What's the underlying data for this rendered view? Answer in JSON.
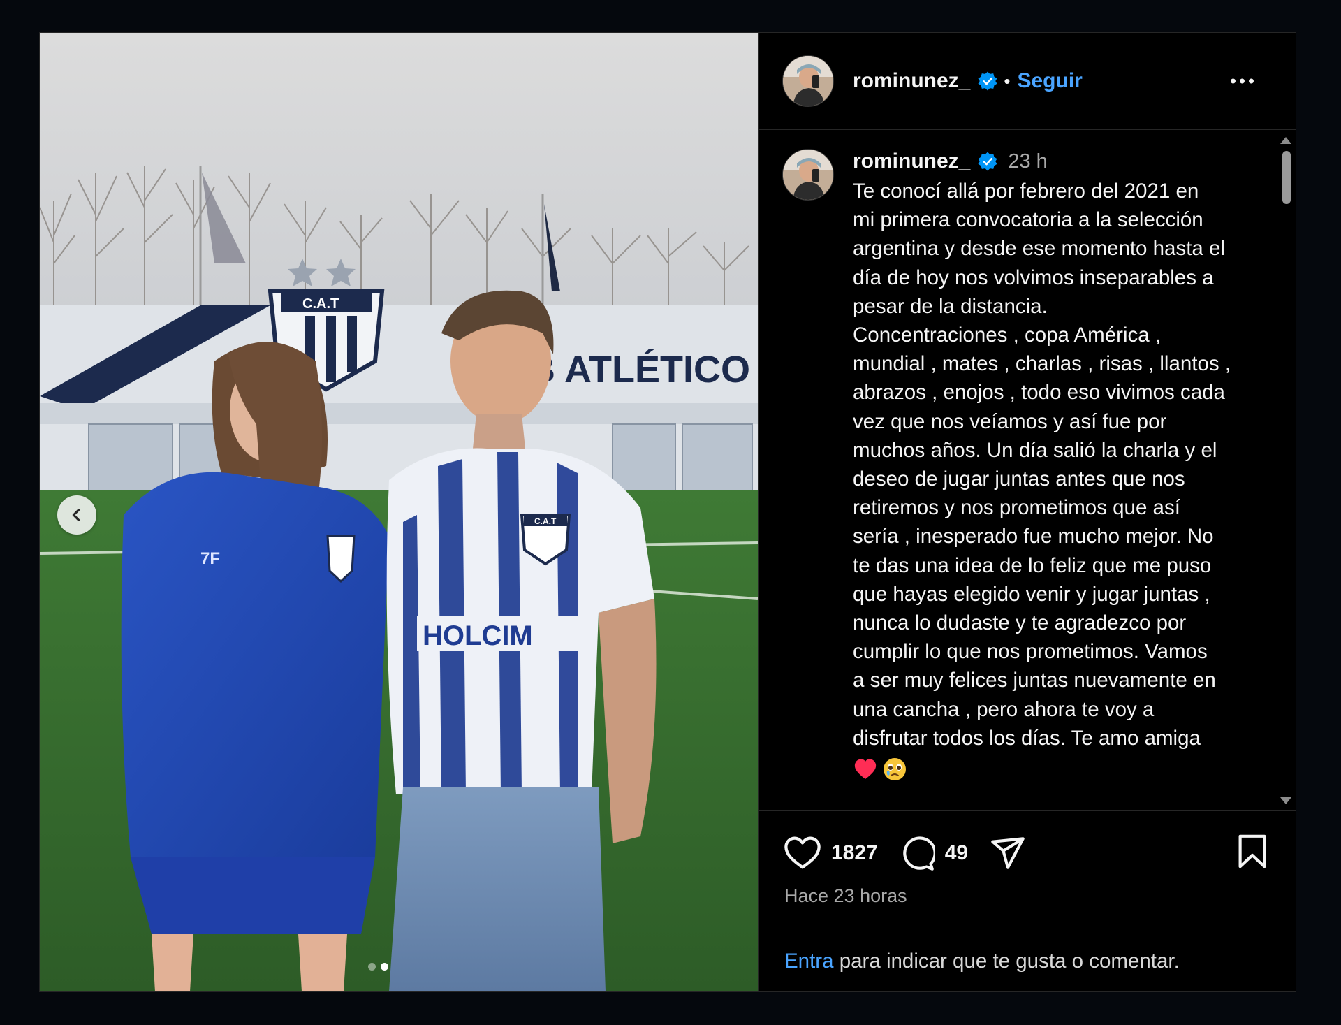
{
  "post": {
    "username": "rominunez_",
    "follow_label": "Seguir",
    "separator": "•",
    "caption_time": "23 h",
    "caption_text": "Te conocí allá por febrero del 2021 en\nmi primera convocatoria a la selección\nargentina y desde ese momento hasta el\ndía de hoy nos volvimos inseparables a\npesar de la distancia.\nConcentraciones , copa América ,\nmundial , mates , charlas , risas , llantos ,\nabrazos , enojos , todo eso vivimos cada\nvez que nos veíamos y así fue por\nmuchos años. Un día salió la charla y el\ndeseo de jugar juntas antes que nos\nretiremos y nos prometimos que así\nsería , inesperado fue mucho mejor. No\nte das una idea de lo feliz que me puso\nque hayas elegido venir y jugar juntas ,\nnunca lo dudaste y te agradezco por\ncumplir lo que nos prometimos. Vamos\na ser muy felices juntas nuevamente en\nuna cancha , pero ahora te voy a\ndisfrutar todos los días. Te amo amiga",
    "caption_emojis": [
      "heart-emoji",
      "crying-face-emoji"
    ],
    "likes": "1827",
    "comments": "49",
    "time_ago": "Hace 23 horas",
    "login_link": "Entra",
    "login_text": " para indicar que te gusta o comentar."
  },
  "media": {
    "photo_text": {
      "building_sign": "UB ATLÉTICO T",
      "crest_label": "C.A.T",
      "shirt_sponsor": "HOLCIM",
      "shirt_crest": "C.A.T",
      "jacket_tag": "7F"
    },
    "carousel": {
      "total": 2,
      "active_index": 1
    }
  },
  "colors": {
    "background": "#05080d",
    "panel": "#000000",
    "link_blue": "#4aa4ff",
    "verified_blue": "#0095f6",
    "muted_text": "#a8a8a8",
    "divider": "#262626"
  },
  "icons": [
    "chevron-left-icon",
    "verified-badge-icon",
    "more-options-icon",
    "heart-icon",
    "comment-icon",
    "share-icon",
    "bookmark-icon"
  ]
}
